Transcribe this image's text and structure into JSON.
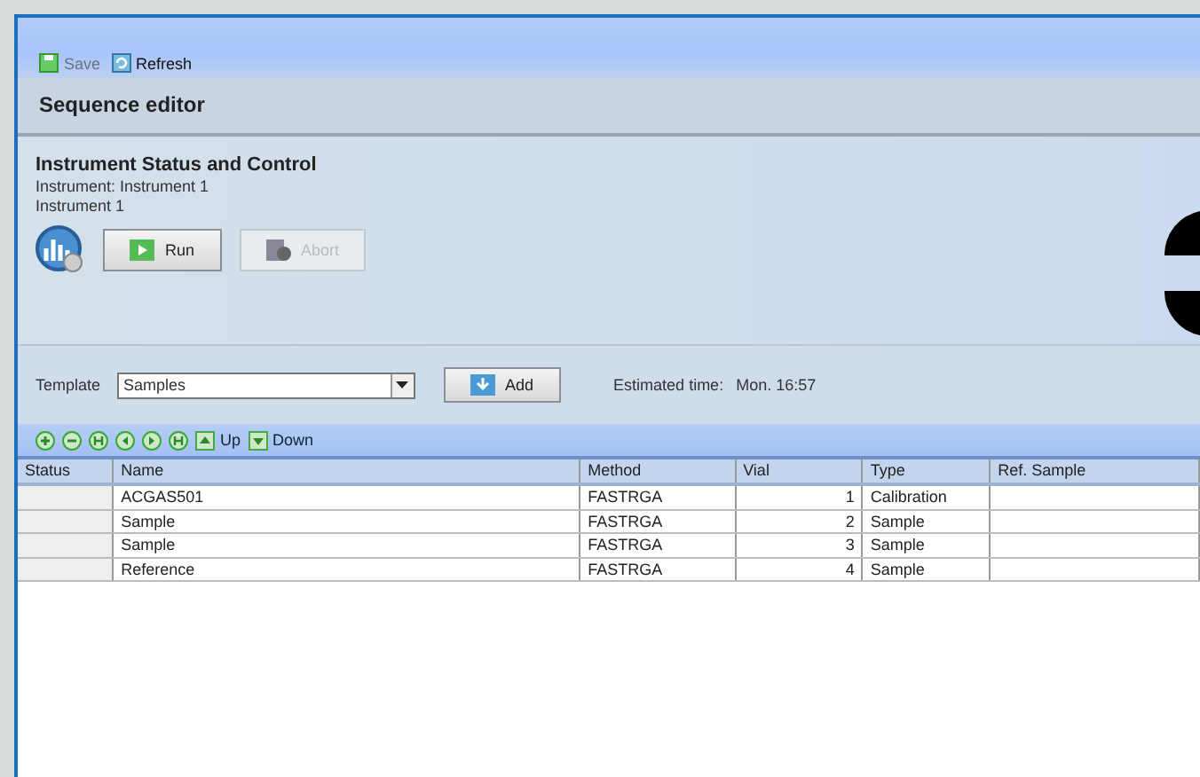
{
  "toolbar": {
    "buttons": [
      {
        "label": "Save",
        "disabled": true,
        "kind": "save"
      },
      {
        "label": "Refresh",
        "disabled": false,
        "kind": "refresh"
      }
    ]
  },
  "panel_title": "Sequence editor",
  "instrument": {
    "heading": "Instrument Status and Control",
    "line_1": "Instrument: Instrument 1",
    "line_2": "Instrument 1",
    "buttons": [
      {
        "label": "Run",
        "disabled": false,
        "kind": "run"
      },
      {
        "label": "Abort",
        "disabled": true,
        "kind": "abort"
      }
    ]
  },
  "template": {
    "label": "Template",
    "value": "Samples",
    "add_button": "Add",
    "estimated_label": "Estimated time:",
    "estimated_value": "Mon. 16:57"
  },
  "nav_toolbar": [
    {
      "kind": "add"
    },
    {
      "kind": "remove"
    },
    {
      "kind": "first"
    },
    {
      "kind": "prev"
    },
    {
      "kind": "next"
    },
    {
      "kind": "last"
    },
    {
      "kind": "up",
      "label": "Up"
    },
    {
      "kind": "down",
      "label": "Down"
    }
  ],
  "table": {
    "columns": [
      "Status",
      "Name",
      "Method",
      "Vial",
      "Type",
      "Ref. Sample"
    ],
    "rows": [
      [
        "",
        "ACGAS501",
        "FASTRGA",
        "1",
        "Calibration",
        ""
      ],
      [
        "",
        "Sample",
        "FASTRGA",
        "2",
        "Sample",
        ""
      ],
      [
        "",
        "Sample",
        "FASTRGA",
        "3",
        "Sample",
        ""
      ],
      [
        "",
        "Reference",
        "FASTRGA",
        "4",
        "Sample",
        ""
      ]
    ]
  }
}
